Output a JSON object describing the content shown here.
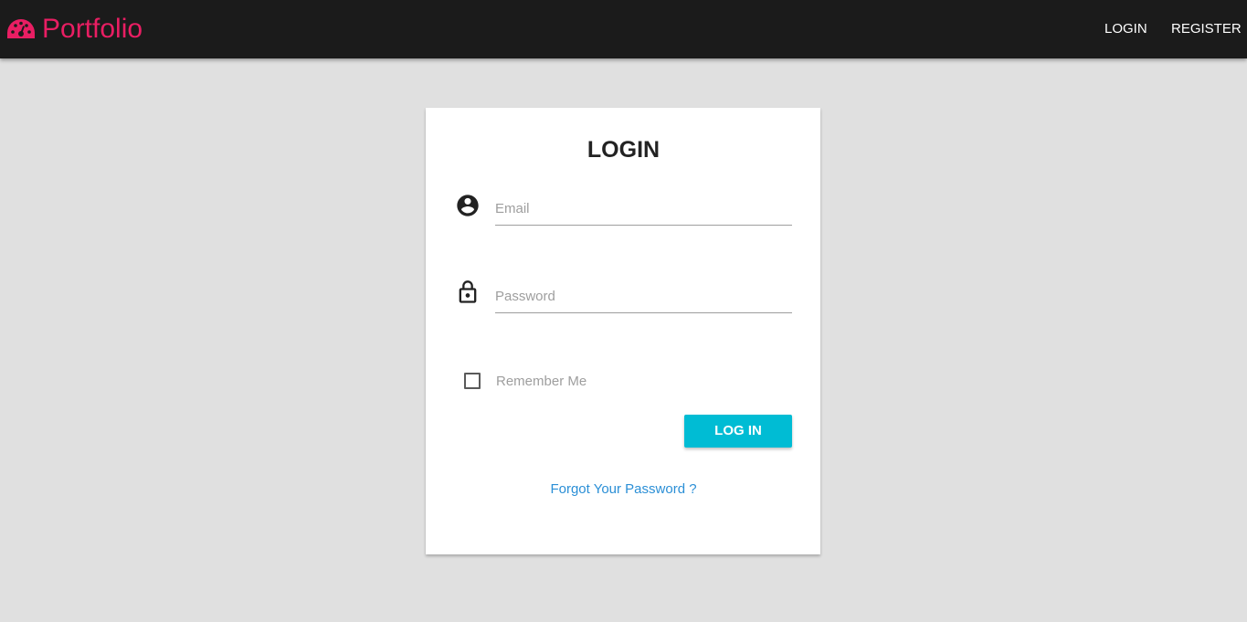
{
  "brand": {
    "name": "Portfolio",
    "icon": "dashboard-gauge-icon",
    "color": "#e91e63"
  },
  "nav": {
    "login": "LOGIN",
    "register": "REGISTER"
  },
  "login_card": {
    "title": "LOGIN",
    "email": {
      "placeholder": "Email",
      "value": "",
      "icon": "account-circle-icon"
    },
    "password": {
      "placeholder": "Password",
      "value": "",
      "icon": "lock-icon"
    },
    "remember_me": {
      "label": "Remember Me",
      "checked": false
    },
    "submit_label": "LOG IN",
    "forgot_link": "Forgot Your Password ?"
  },
  "colors": {
    "navbar": "#1b1b1b",
    "background": "#e0e0e0",
    "accent_button": "#00bcd4",
    "link": "#2196f3"
  }
}
